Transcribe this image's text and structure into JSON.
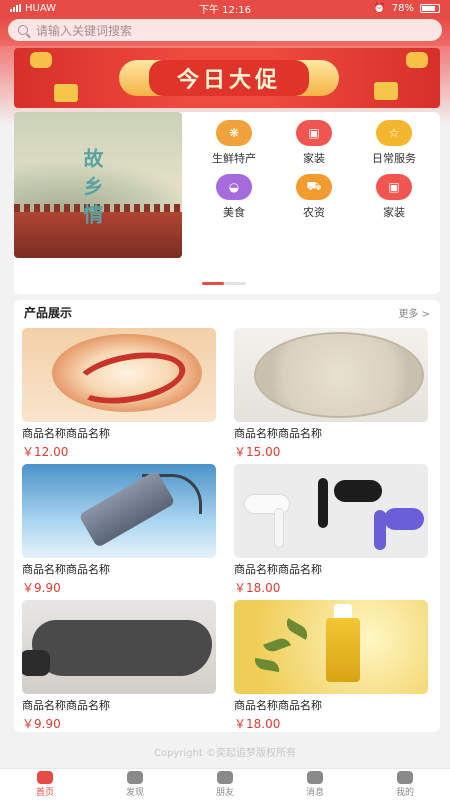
{
  "status_bar": {
    "carrier": "HUAW",
    "time": "下午 12:16",
    "battery": "78%"
  },
  "search": {
    "placeholder": "请输入关键词搜索"
  },
  "banner": {
    "title": "今日大促"
  },
  "promo": {
    "text": "故乡情"
  },
  "categories": [
    {
      "label": "生鲜特产",
      "icon": "food-icon",
      "color": "#f2a23a"
    },
    {
      "label": "家装",
      "icon": "home-icon",
      "color": "#f0564f"
    },
    {
      "label": "日常服务",
      "icon": "star-icon",
      "color": "#f3b62f"
    },
    {
      "label": "美食",
      "icon": "dish-icon",
      "color": "#a56bdc"
    },
    {
      "label": "农资",
      "icon": "tractor-icon",
      "color": "#f29c2f"
    },
    {
      "label": "家装",
      "icon": "home-icon",
      "color": "#f0564f"
    }
  ],
  "products_section": {
    "title": "产品展示",
    "more": "更多 >"
  },
  "products": [
    {
      "name": "商品名称商品名称",
      "price": "￥12.00"
    },
    {
      "name": "商品名称商品名称",
      "price": "￥15.00"
    },
    {
      "name": "商品名称商品名称",
      "price": "￥9.90"
    },
    {
      "name": "商品名称商品名称",
      "price": "￥18.00"
    },
    {
      "name": "商品名称商品名称",
      "price": "￥9.90"
    },
    {
      "name": "商品名称商品名称",
      "price": "￥18.00"
    }
  ],
  "copyright": "Copyright ©奕起追梦版权所有",
  "tabs": [
    {
      "label": "首页",
      "icon": "home-icon",
      "active": true
    },
    {
      "label": "发现",
      "icon": "discover-icon"
    },
    {
      "label": "朋友",
      "icon": "friends-icon"
    },
    {
      "label": "消息",
      "icon": "message-icon"
    },
    {
      "label": "我的",
      "icon": "profile-icon"
    }
  ],
  "colors": {
    "brand": "#e64b45",
    "price": "#e03a32"
  }
}
